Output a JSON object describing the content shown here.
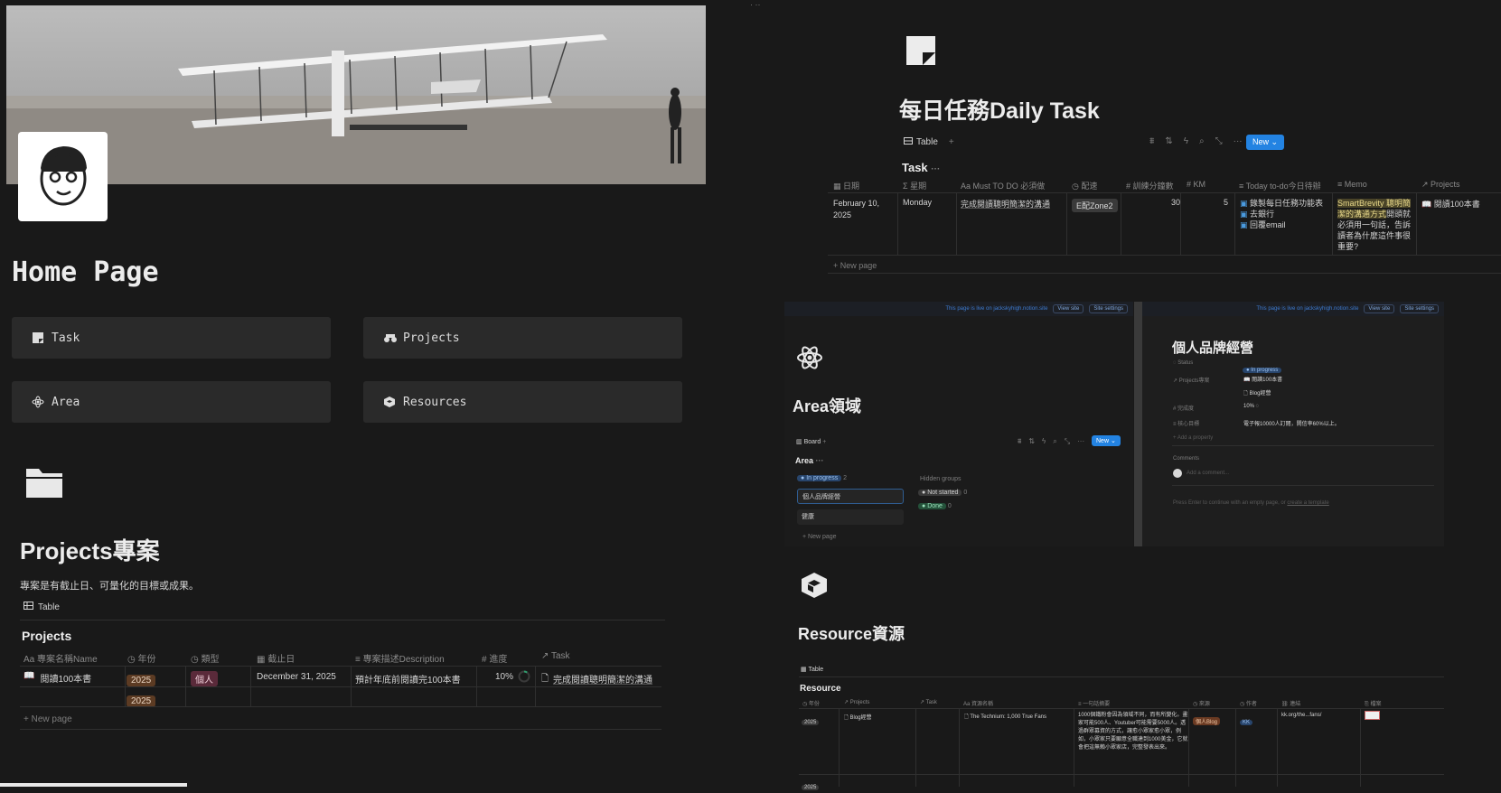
{
  "home": {
    "title": "Home Page",
    "links": [
      {
        "label": "Task",
        "icon": "task-icon"
      },
      {
        "label": "Projects",
        "icon": "projects-icon"
      },
      {
        "label": "Area",
        "icon": "area-icon"
      },
      {
        "label": "Resources",
        "icon": "resources-icon"
      }
    ]
  },
  "projects": {
    "title": "Projects專案",
    "description": "專案是有截止日、可量化的目標或成果。",
    "view_label": "Table",
    "db_title": "Projects",
    "columns": [
      "專案名稱Name",
      "年份",
      "類型",
      "截止日",
      "專案描述Description",
      "進度",
      "Task"
    ],
    "rows": [
      {
        "name": "閱讀100本書",
        "year": "2025",
        "type": "個人",
        "deadline": "December 31, 2025",
        "description": "預計年底前閱讀完100本書",
        "progress": "10%",
        "task": "完成閱讀聰明簡潔的溝通"
      },
      {
        "name": "",
        "year": "2025",
        "type": "",
        "deadline": "",
        "description": "",
        "progress": "",
        "task": ""
      }
    ],
    "new_page": "New page"
  },
  "daily": {
    "title": "每日任務Daily Task",
    "view_label": "Table",
    "db_title": "Task",
    "new_label": "New",
    "columns": [
      "日期",
      "星期",
      "Must TO DO 必須做",
      "配速",
      "訓練分鐘數",
      "KM",
      "Today to-do今日待辦",
      "Memo",
      "Projects"
    ],
    "row": {
      "date_line1": "February 10,",
      "date_line2": "2025",
      "weekday": "Monday",
      "must_do": "完成閱讀聰明簡潔的溝通",
      "pace": "E配Zone2",
      "minutes": "30",
      "km": "5",
      "todos": [
        "錄製每日任務功能表",
        "去銀行",
        "回覆email"
      ],
      "memo_highlight": "SmartBrevity 聰明簡潔的溝通方式",
      "memo_rest": "開頭就必須用一句話，告訴讀者為什麼這件事很重要?",
      "project": "閱讀100本書"
    },
    "new_page": "New page"
  },
  "area": {
    "site_notice": "This page is live on jackskyhigh.notion.site",
    "view_site": "View site",
    "site_settings": "Site settings",
    "title": "Area領域",
    "view_label": "Board",
    "db_title": "Area",
    "new_label": "New",
    "in_progress": "In progress",
    "in_progress_count": "2",
    "cards": [
      "個人品牌經營",
      "健康"
    ],
    "new_page": "New page",
    "hidden_groups": "Hidden groups",
    "not_started": "Not started",
    "not_started_count": "0",
    "done": "Done",
    "done_count": "0"
  },
  "detail": {
    "site_notice": "This page is live on jackskyhigh.notion.site",
    "view_site": "View site",
    "site_settings": "Site settings",
    "title": "個人品牌經營",
    "props": [
      {
        "label": "Status",
        "value": "In progress"
      },
      {
        "label": "Projects專案",
        "value": "閱讀100本書"
      },
      {
        "label": "",
        "value": "Blog經營"
      },
      {
        "label": "完成度",
        "value": "10%"
      },
      {
        "label": "核心目標",
        "value": "電子報10000人訂閱，開信率60%以上。"
      }
    ],
    "add_property": "Add a property",
    "comments": "Comments",
    "add_comment": "Add a comment...",
    "hint_prefix": "Press Enter to continue with an empty page, or",
    "hint_link": "create a template"
  },
  "resource": {
    "title": "Resource資源",
    "view_label": "Table",
    "db_title": "Resource",
    "columns": [
      "年份",
      "Projects",
      "Task",
      "資源名稱",
      "一句話摘要",
      "來源",
      "作者",
      "連結",
      "檔案"
    ],
    "row": {
      "year": "2025",
      "project": "Blog經營",
      "name": "The Technium: 1,000 True Fans",
      "summary": "1000個鐵粉會因為領域不同，而有所變化。畫家可能500人、Youtuber可能需要5000人。透過群眾募資的方式，讓愈小眾家愈小眾，例如，小眾家只要願意全職達到1000美金，它就會把這無賴小眾家店，完整發表出來。",
      "source": "個人Blog",
      "author": "KK",
      "link": "kk.org/the...fans/"
    },
    "year2": "2025"
  },
  "colors": {
    "accent": "#2383e2",
    "bg": "#191919",
    "card": "#2a2a2a"
  }
}
